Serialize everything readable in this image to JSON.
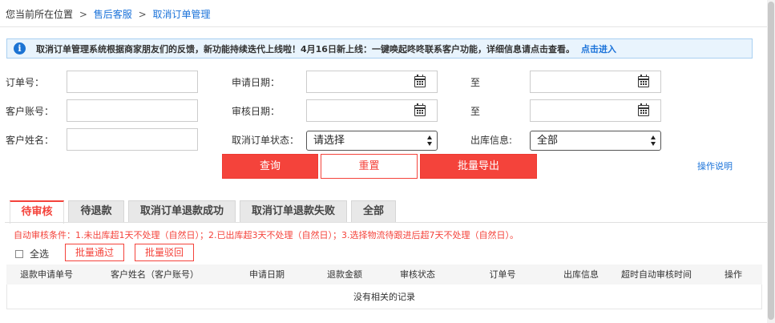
{
  "breadcrumb": {
    "current_label": "您当前所在位置",
    "separator": ">",
    "items": [
      "售后客服",
      "取消订单管理"
    ]
  },
  "notice": {
    "text": "取消订单管理系统根据商家朋友们的反馈，新功能持续迭代上线啦！4月16日新上线：一键唤起咚咚联系客户功能，详细信息请点击查看。",
    "link": "点击进入"
  },
  "filters": {
    "order_no_label": "订单号：",
    "order_no_value": "",
    "customer_account_label": "客户账号：",
    "customer_account_value": "",
    "customer_name_label": "客户姓名：",
    "customer_name_value": "",
    "apply_date_label": "申请日期：",
    "review_date_label": "审核日期：",
    "to_label": "至",
    "cancel_status_label": "取消订单状态：",
    "cancel_status_value": "请选择",
    "outbound_label": "出库信息:",
    "outbound_value": "全部"
  },
  "actions": {
    "query": "查询",
    "reset": "重置",
    "export": "批量导出",
    "help": "操作说明"
  },
  "tabs": [
    "待审核",
    "待退款",
    "取消订单退款成功",
    "取消订单退款失败",
    "全部"
  ],
  "active_tab": "待审核",
  "rule_text": "自动审核条件：1.未出库超1天不处理（自然日）；2.已出库超3天不处理（自然日）；3.选择物流待跟进后超7天不处理（自然日）。",
  "bulk": {
    "select_all": "全选",
    "approve": "批量通过",
    "reject": "批量驳回"
  },
  "table": {
    "columns": [
      "退款申请单号",
      "客户姓名（客户账号）",
      "申请日期",
      "退款金额",
      "审核状态",
      "订单号",
      "出库信息",
      "超时自动审核时间",
      "操作"
    ],
    "empty_text": "没有相关的记录",
    "rows": []
  },
  "colors": {
    "accent_red": "#f4433b",
    "link_blue": "#1a72d9",
    "notice_bg": "#e9f4fd",
    "notice_border": "#a9d0f1"
  }
}
